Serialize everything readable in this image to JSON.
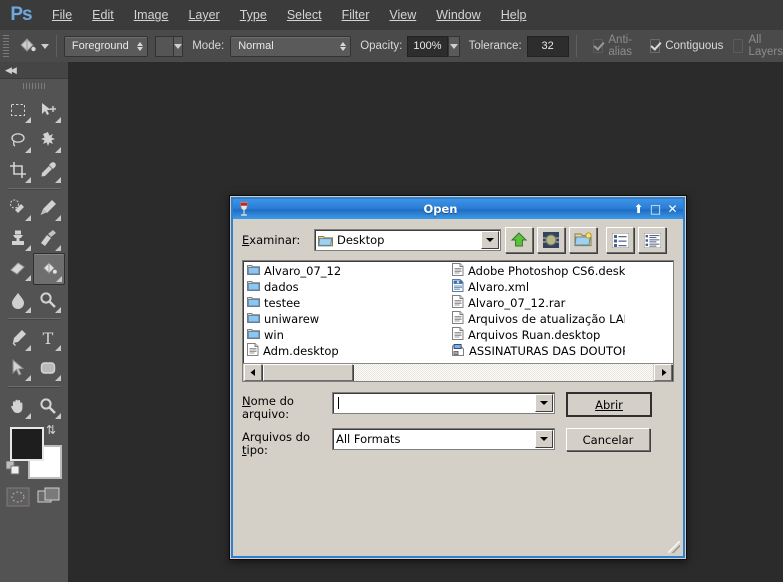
{
  "app": {
    "logo": "Ps",
    "menu": [
      {
        "label": "File",
        "accel": "F"
      },
      {
        "label": "Edit",
        "accel": "E"
      },
      {
        "label": "Image",
        "accel": "I"
      },
      {
        "label": "Layer",
        "accel": "L"
      },
      {
        "label": "Type",
        "accel": "T"
      },
      {
        "label": "Select",
        "accel": "S"
      },
      {
        "label": "Filter",
        "accel": "F"
      },
      {
        "label": "View",
        "accel": "V"
      },
      {
        "label": "Window",
        "accel": "W"
      },
      {
        "label": "Help",
        "accel": "H"
      }
    ]
  },
  "options_bar": {
    "tool_icon": "paint-bucket-icon",
    "fill_source": "Foreground",
    "mode_label": "Mode:",
    "mode_value": "Normal",
    "opacity_label": "Opacity:",
    "opacity_value": "100%",
    "tolerance_label": "Tolerance:",
    "tolerance_value": "32",
    "antialias_label": "Anti-alias",
    "antialias_checked": true,
    "antialias_enabled": false,
    "contiguous_label": "Contiguous",
    "contiguous_checked": true,
    "contiguous_enabled": true,
    "all_layers_label": "All Layers",
    "all_layers_checked": false,
    "all_layers_enabled": false
  },
  "tools_panel": {
    "collapse": "◀◀",
    "tools": [
      {
        "name": "rectangular-marquee-tool",
        "selected": false
      },
      {
        "name": "move-tool",
        "selected": false
      },
      {
        "name": "lasso-tool",
        "selected": false
      },
      {
        "name": "magic-wand-tool",
        "selected": false
      },
      {
        "name": "crop-tool",
        "selected": false
      },
      {
        "name": "eyedropper-tool",
        "selected": false
      },
      {
        "name": "spot-healing-brush-tool",
        "selected": false
      },
      {
        "name": "brush-tool",
        "selected": false
      },
      {
        "name": "clone-stamp-tool",
        "selected": false
      },
      {
        "name": "history-brush-tool",
        "selected": false
      },
      {
        "name": "eraser-tool",
        "selected": false
      },
      {
        "name": "paint-bucket-tool",
        "selected": true
      },
      {
        "name": "blur-tool",
        "selected": false
      },
      {
        "name": "dodge-tool",
        "selected": false
      },
      {
        "name": "pen-tool",
        "selected": false
      },
      {
        "name": "type-tool",
        "selected": false
      },
      {
        "name": "path-selection-tool",
        "selected": false
      },
      {
        "name": "rounded-rectangle-tool",
        "selected": false
      },
      {
        "name": "hand-tool",
        "selected": false
      },
      {
        "name": "zoom-tool",
        "selected": false
      }
    ],
    "foreground_color": "#1e1e1e",
    "background_color": "#ffffff",
    "quick_mask_name": "quick-mask-button",
    "screen_mode_name": "screen-mode-button"
  },
  "dialog": {
    "title": "Open",
    "app_icon": "wine-glass-icon",
    "title_buttons": [
      {
        "name": "rollup-button",
        "glyph": "⬆"
      },
      {
        "name": "maximize-button",
        "glyph": "□"
      },
      {
        "name": "close-button",
        "glyph": "✕"
      }
    ],
    "lookin_label": "Examinar:",
    "lookin_label_accel": "E",
    "lookin_value": "Desktop",
    "toolbar_buttons": [
      {
        "name": "up-one-level-button",
        "icon": "green-up-arrow-icon"
      },
      {
        "name": "desktop-button",
        "icon": "desktop-icon"
      },
      {
        "name": "new-folder-button",
        "icon": "new-folder-icon"
      },
      {
        "name": "list-view-button",
        "icon": "list-view-icon"
      },
      {
        "name": "details-view-button",
        "icon": "details-view-icon"
      }
    ],
    "files_col1": [
      {
        "label": "Alvaro_07_12",
        "type": "folder"
      },
      {
        "label": "dados",
        "type": "folder"
      },
      {
        "label": "testee",
        "type": "folder"
      },
      {
        "label": "uniwarew",
        "type": "folder"
      },
      {
        "label": "win",
        "type": "folder"
      },
      {
        "label": "Adm.desktop",
        "type": "file"
      }
    ],
    "files_col2": [
      {
        "label": "Adobe Photoshop CS6.desktop",
        "type": "file"
      },
      {
        "label": "Alvaro.xml",
        "type": "xml"
      },
      {
        "label": "Alvaro_07_12.rar",
        "type": "file"
      },
      {
        "label": "Arquivos de atualização LAB A",
        "type": "file"
      },
      {
        "label": "Arquivos Ruan.desktop",
        "type": "file"
      },
      {
        "label": "ASSINATURAS DAS DOUTORA",
        "type": "app"
      }
    ],
    "filename_label_line1": "Nome do",
    "filename_label_line2": "arquivo:",
    "filename_label_accel": "N",
    "filename_value": "",
    "filetype_label": "Arquivos do tipo:",
    "filetype_label_accel": "t",
    "filetype_value": "All Formats",
    "open_button": "Abrir",
    "open_button_accel": "A",
    "cancel_button": "Cancelar"
  },
  "colors": {
    "app_bg": "#2b2b2b",
    "menubar_bg": "#3b3b3b",
    "optionsbar_bg": "#4a4a4a",
    "panel_bg": "#535353",
    "dialog_face": "#d4d0c8",
    "dialog_accent": "#2f7fd0",
    "ps_blue": "#6fa8dc"
  }
}
